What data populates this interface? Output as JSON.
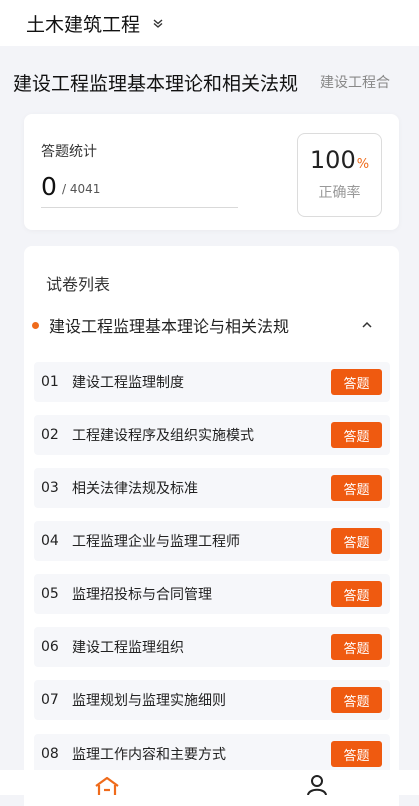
{
  "header": {
    "category": "土木建筑工程"
  },
  "subjects": {
    "active": "建设工程监理基本理论和相关法规",
    "next": "建设工程合"
  },
  "stats": {
    "label": "答题统计",
    "answered": "0",
    "total": "/ 4041",
    "rate_value": "100",
    "rate_unit": "%",
    "rate_label": "正确率"
  },
  "paper_list": {
    "title": "试卷列表",
    "group_label": "建设工程监理基本理论与相关法规",
    "items": [
      {
        "num": "01",
        "name": "建设工程监理制度",
        "action": "答题"
      },
      {
        "num": "02",
        "name": "工程建设程序及组织实施模式",
        "action": "答题"
      },
      {
        "num": "03",
        "name": "相关法律法规及标准",
        "action": "答题"
      },
      {
        "num": "04",
        "name": "工程监理企业与监理工程师",
        "action": "答题"
      },
      {
        "num": "05",
        "name": "监理招投标与合同管理",
        "action": "答题"
      },
      {
        "num": "06",
        "name": "建设工程监理组织",
        "action": "答题"
      },
      {
        "num": "07",
        "name": "监理规划与监理实施细则",
        "action": "答题"
      },
      {
        "num": "08",
        "name": "监理工作内容和主要方式",
        "action": "答题"
      }
    ]
  },
  "tabbar": {
    "home_icon": "home-icon",
    "profile_icon": "user-icon",
    "accent": "#ef6b1b"
  },
  "colors": {
    "accent": "#ef5a10",
    "background": "#f3f4f8"
  }
}
